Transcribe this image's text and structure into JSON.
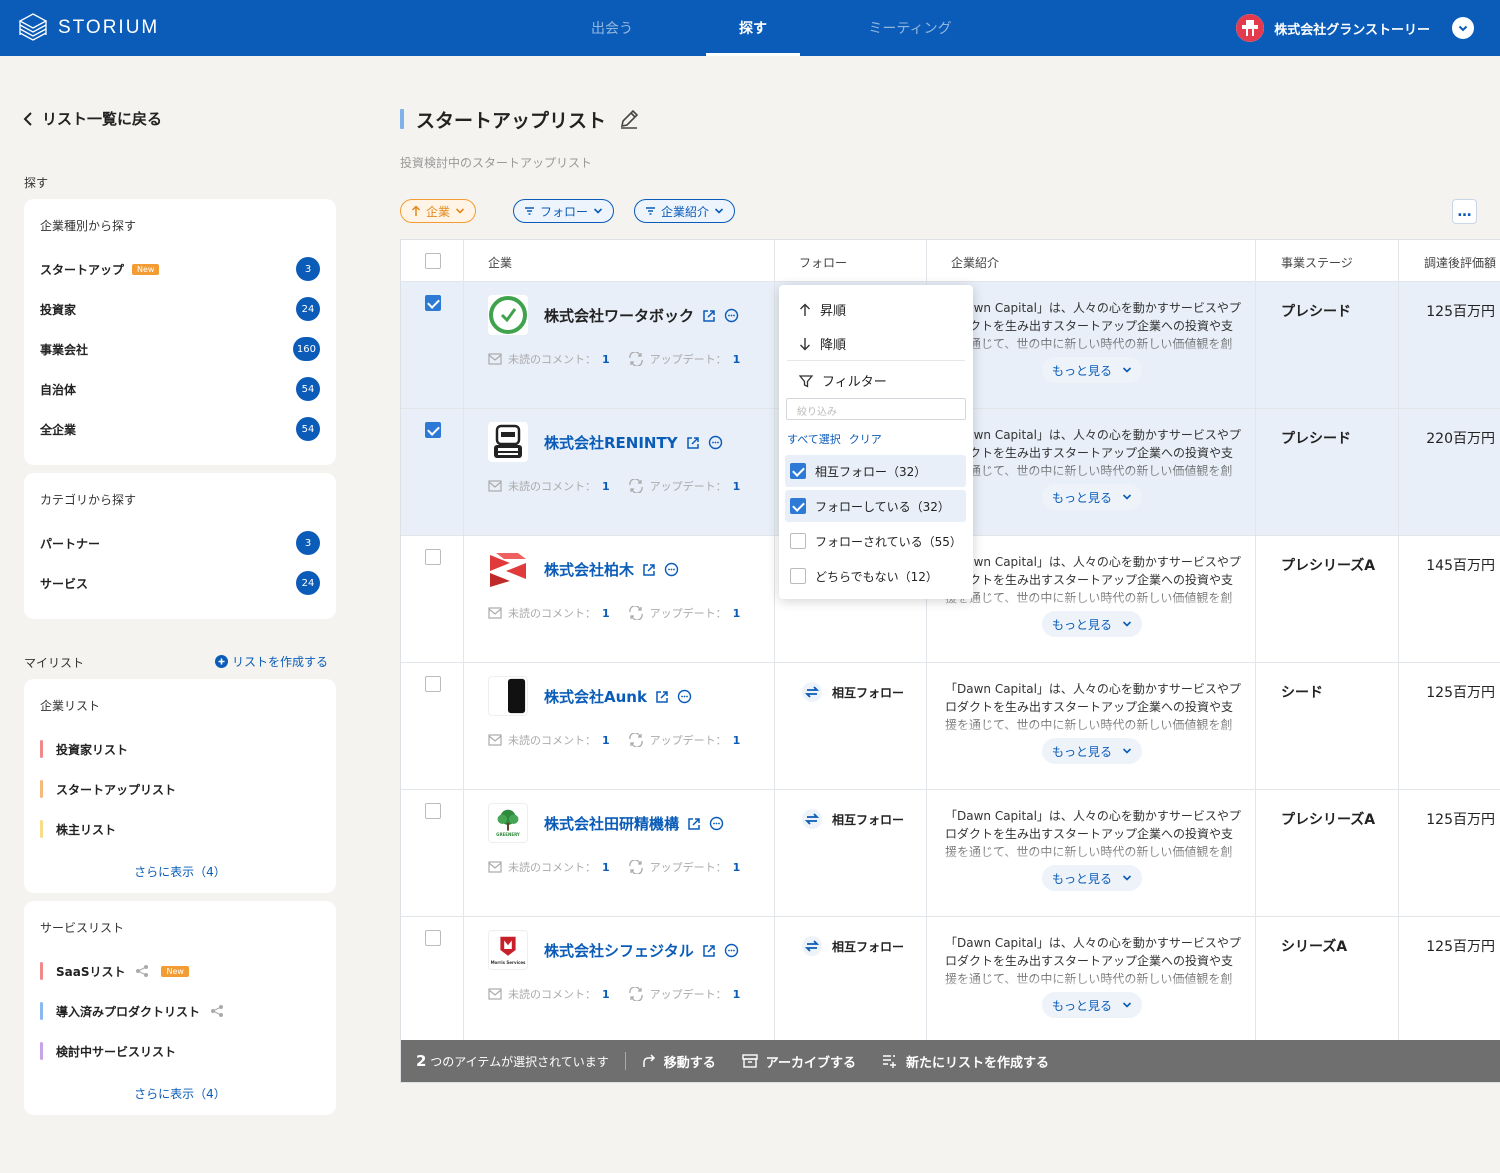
{
  "header": {
    "brand": "STORIUM",
    "tabs": [
      "出会う",
      "探す",
      "ミーティング"
    ],
    "active_tab": "探す",
    "user_name": "株式会社グランストーリー"
  },
  "sidebar": {
    "back_label": "リスト一覧に戻る",
    "search_label": "探す",
    "type_card": {
      "title": "企業種別から探す",
      "items": [
        {
          "label": "スタートアップ",
          "count": "3",
          "badge": "New"
        },
        {
          "label": "投資家",
          "count": "24"
        },
        {
          "label": "事業会社",
          "count": "160"
        },
        {
          "label": "自治体",
          "count": "54"
        },
        {
          "label": "全企業",
          "count": "54"
        }
      ]
    },
    "category_card": {
      "title": "カテゴリから探す",
      "items": [
        {
          "label": "パートナー",
          "count": "3"
        },
        {
          "label": "サービス",
          "count": "24"
        }
      ]
    },
    "mylist_label": "マイリスト",
    "create_list": "リストを作成する",
    "company_lists": {
      "title": "企業リスト",
      "items": [
        {
          "label": "投資家リスト",
          "color": "#f08a8a"
        },
        {
          "label": "スタートアップリスト",
          "color": "#f5b97a"
        },
        {
          "label": "株主リスト",
          "color": "#f7dc8a"
        }
      ],
      "more": "さらに表示（4）"
    },
    "service_lists": {
      "title": "サービスリスト",
      "items": [
        {
          "label": "SaaSリスト",
          "color": "#f08a8a",
          "badge": "New"
        },
        {
          "label": "導入済みプロダクトリスト",
          "color": "#8ab8f0"
        },
        {
          "label": "検討中サービスリスト",
          "color": "#c9a3e8"
        }
      ],
      "more": "さらに表示（4）"
    }
  },
  "main": {
    "title": "スタートアップリスト",
    "description": "投資検討中のスタートアップリスト",
    "filters": [
      "企業",
      "フォロー",
      "企業紹介"
    ],
    "more_menu": "…",
    "columns": [
      "企業",
      "フォロー",
      "企業紹介",
      "事業ステージ",
      "調達後評価額"
    ],
    "rows": [
      {
        "name": "株式会社ワータボック",
        "comment_label": "未読のコメント：",
        "comment_count": "1",
        "update_label": "アップデート：",
        "update_count": "1",
        "follow": "",
        "intro": "「Dawn Capital」は、人々の心を動かすサービスやプロダクトを生み出すスタートアップ企業への投資や支援を通じて、世の中に新しい時代の新しい価値観を創",
        "more": "もっと見る",
        "stage": "プレシード",
        "valuation": "125百万円",
        "selected": true
      },
      {
        "name": "株式会社RENINTY",
        "comment_label": "未読のコメント：",
        "comment_count": "1",
        "update_label": "アップデート：",
        "update_count": "1",
        "follow": "",
        "intro": "「Dawn Capital」は、人々の心を動かすサービスやプロダクトを生み出すスタートアップ企業への投資や支援を通じて、世の中に新しい時代の新しい価値観を創",
        "more": "もっと見る",
        "stage": "プレシード",
        "valuation": "220百万円",
        "selected": true
      },
      {
        "name": "株式会社柏木",
        "comment_label": "未読のコメント：",
        "comment_count": "1",
        "update_label": "アップデート：",
        "update_count": "1",
        "follow": "",
        "intro": "「Dawn Capital」は、人々の心を動かすサービスやプロダクトを生み出すスタートアップ企業への投資や支援を通じて、世の中に新しい時代の新しい価値観を創",
        "more": "もっと見る",
        "stage": "プレシリーズA",
        "valuation": "145百万円",
        "selected": false
      },
      {
        "name": "株式会社Aunk",
        "comment_label": "未読のコメント：",
        "comment_count": "1",
        "update_label": "アップデート：",
        "update_count": "1",
        "follow": "相互フォロー",
        "intro": "「Dawn Capital」は、人々の心を動かすサービスやプロダクトを生み出すスタートアップ企業への投資や支援を通じて、世の中に新しい時代の新しい価値観を創",
        "more": "もっと見る",
        "stage": "シード",
        "valuation": "125百万円",
        "selected": false
      },
      {
        "name": "株式会社田研精機構",
        "comment_label": "未読のコメント：",
        "comment_count": "1",
        "update_label": "アップデート：",
        "update_count": "1",
        "follow": "相互フォロー",
        "intro": "「Dawn Capital」は、人々の心を動かすサービスやプロダクトを生み出すスタートアップ企業への投資や支援を通じて、世の中に新しい時代の新しい価値観を創",
        "more": "もっと見る",
        "stage": "プレシリーズA",
        "valuation": "125百万円",
        "selected": false
      },
      {
        "name": "株式会社シフェジタル",
        "comment_label": "未読のコメント：",
        "comment_count": "1",
        "update_label": "アップデート：",
        "update_count": "1",
        "follow": "相互フォロー",
        "intro": "「Dawn Capital」は、人々の心を動かすサービスやプロダクトを生み出すスタートアップ企業への投資や支援を通じて、世の中に新しい時代の新しい価値観を創",
        "more": "もっと見る",
        "stage": "シリーズA",
        "valuation": "125百万円",
        "selected": false
      }
    ],
    "logo_texts": {
      "greenery": "GREENERY",
      "morris": "Morris Services"
    }
  },
  "dropdown": {
    "asc": "昇順",
    "desc": "降順",
    "filter": "フィルター",
    "search_placeholder": "絞り込み",
    "select_all": "すべて選択",
    "clear": "クリア",
    "options": [
      {
        "label": "相互フォロー（32）",
        "checked": true
      },
      {
        "label": "フォローしている（32）",
        "checked": true
      },
      {
        "label": "フォローされている（55）",
        "checked": false
      },
      {
        "label": "どちらでもない（12）",
        "checked": false
      }
    ]
  },
  "action_bar": {
    "count": "2",
    "selected_text": "つのアイテムが選択されています",
    "move": "移動する",
    "archive": "アーカイブする",
    "new_list": "新たにリストを作成する"
  },
  "colors": {
    "primary": "#0a5cb8",
    "accent_orange": "#f39c33",
    "selected_row": "#e8eff8"
  }
}
